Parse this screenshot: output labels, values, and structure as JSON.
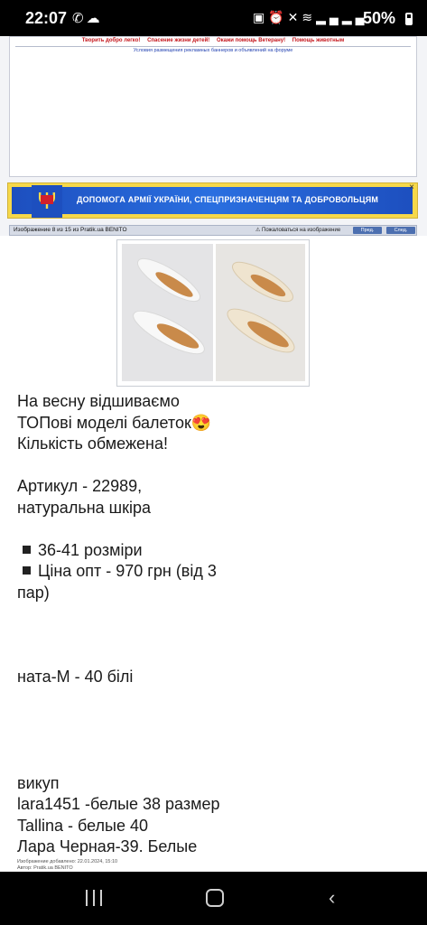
{
  "status_bar": {
    "time": "22:07",
    "left_icons": [
      "phone-icon",
      "cloud-icon"
    ],
    "right_icons": [
      "nfc-icon",
      "alarm-icon",
      "mute-icon",
      "wifi-icon",
      "signal-icon",
      "signal-icon"
    ],
    "battery": "50%"
  },
  "ad": {
    "charity_links": [
      "Творить добро легко!",
      "Спасение жизни детей!",
      "Окажи помощь Ветерану!",
      "Помощь животным"
    ],
    "terms": "Условия размещения рекламных баннеров и объявлений на форуме"
  },
  "ua_banner": {
    "text": "ДОПОМОГА АРМІЇ УКРАЇНИ, СПЕЦПРИЗНАЧЕНЦЯМ ТА ДОБРОВОЛЬЦЯМ",
    "close": "×"
  },
  "image_toolbar": {
    "counter": "Изображение 8 из 15 из Pratik.ua BENITO",
    "complain": "Пожаловаться на изображение",
    "prev": "Пред.",
    "next": "След."
  },
  "post": {
    "line1": "На весну відшиваємо",
    "line2": "ТОПові моделі балеток😍",
    "line3": "Кількість обмежена!",
    "article": "Артикул - 22989,",
    "material": "натуральна шкіра",
    "bullet1": "36-41 розміри",
    "bullet2a": "Ціна опт - 970 грн (від 3",
    "bullet2b": "пар)",
    "order1": "ната-М - 40 білі",
    "buyout_title": "викуп",
    "buy1": "lara1451 -белые 38 размер",
    "buy2": "Tallina - белые 40",
    "buy3": "Лара Черная-39. Белые"
  },
  "meta": {
    "added": "Изображение добавлено:  22.01.2024, 15:10",
    "author": "Автор: Pratik.ua BENITO"
  }
}
